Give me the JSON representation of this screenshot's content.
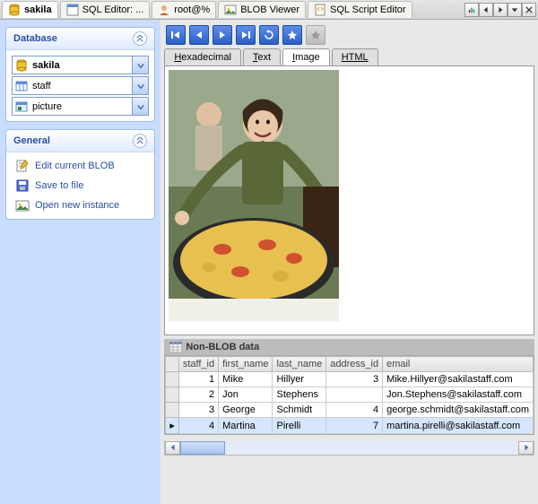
{
  "topTabs": [
    {
      "label": "sakila",
      "icon": "db-icon",
      "active": true
    },
    {
      "label": "SQL Editor: ...",
      "icon": "sql-editor-icon"
    },
    {
      "label": "root@%",
      "icon": "user-icon"
    },
    {
      "label": "BLOB Viewer",
      "icon": "blob-icon"
    },
    {
      "label": "SQL Script Editor",
      "icon": "script-icon"
    }
  ],
  "leftPanels": {
    "database": {
      "title": "Database",
      "combos": [
        {
          "label": "sakila",
          "icon": "db-icon"
        },
        {
          "label": "staff",
          "icon": "table-icon"
        },
        {
          "label": "picture",
          "icon": "image-column-icon"
        }
      ]
    },
    "general": {
      "title": "General",
      "links": [
        {
          "label": "Edit current BLOB",
          "icon": "edit-icon"
        },
        {
          "label": "Save to file",
          "icon": "save-icon"
        },
        {
          "label": "Open new instance",
          "icon": "open-image-icon"
        }
      ]
    }
  },
  "toolbarButtons": [
    {
      "name": "first-record",
      "enabled": true
    },
    {
      "name": "prev-record",
      "enabled": true
    },
    {
      "name": "next-record",
      "enabled": true
    },
    {
      "name": "last-record",
      "enabled": true
    },
    {
      "name": "refresh",
      "enabled": true
    },
    {
      "name": "star",
      "enabled": true
    },
    {
      "name": "star-disabled",
      "enabled": false
    }
  ],
  "viewTabs": [
    {
      "label": "Hexadecimal",
      "ul": "H",
      "rest": "exadecimal"
    },
    {
      "label": "Text",
      "ul": "T",
      "rest": "ext"
    },
    {
      "label": "Image",
      "ul": "I",
      "rest": "mage",
      "active": true
    },
    {
      "label": "HTML",
      "ul": "HTML",
      "rest": ""
    }
  ],
  "nonBlob": {
    "title": "Non-BLOB data",
    "columns": [
      "staff_id",
      "first_name",
      "last_name",
      "address_id",
      "email"
    ],
    "rows": [
      {
        "staff_id": "1",
        "first_name": "Mike",
        "last_name": "Hillyer",
        "address_id": "3",
        "email": "Mike.Hillyer@sakilastaff.com"
      },
      {
        "staff_id": "2",
        "first_name": "Jon",
        "last_name": "Stephens",
        "address_id": "",
        "email": "Jon.Stephens@sakilastaff.com"
      },
      {
        "staff_id": "3",
        "first_name": "George",
        "last_name": "Schmidt",
        "address_id": "4",
        "email": "george.schmidt@sakilastaff.com"
      },
      {
        "staff_id": "4",
        "first_name": "Martina",
        "last_name": "Pirelli",
        "address_id": "7",
        "email": "martina.pirelli@sakilastaff.com",
        "selected": true
      }
    ]
  }
}
